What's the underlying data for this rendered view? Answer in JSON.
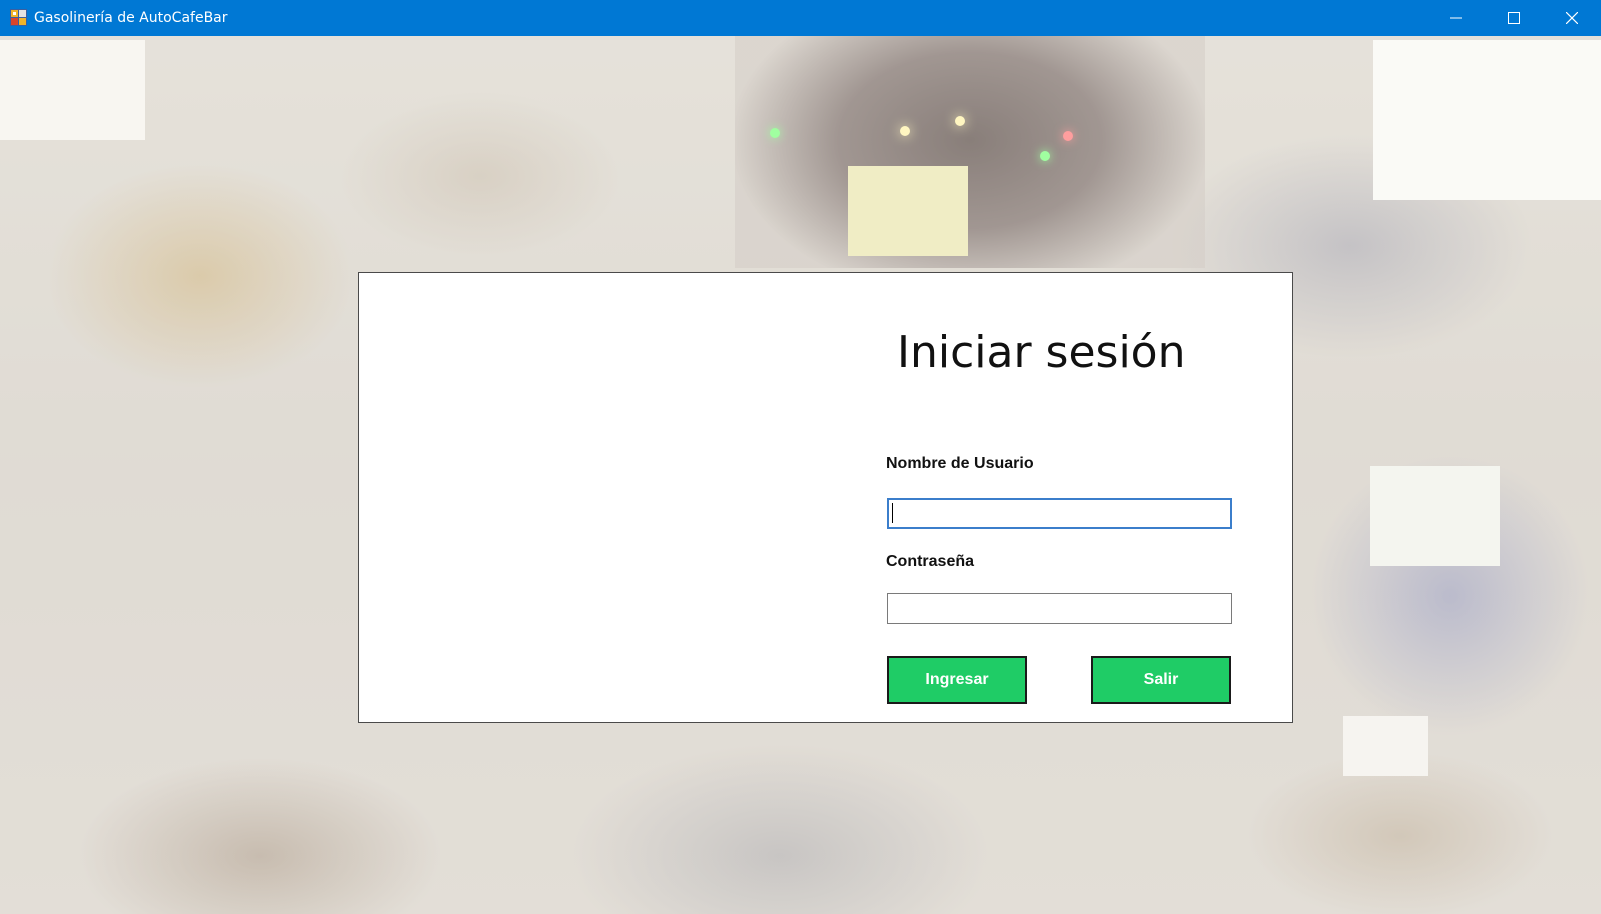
{
  "window": {
    "title": "Gasolinería de AutoCafeBar",
    "controls": {
      "minimize": "minimize-icon",
      "maximize": "maximize-icon",
      "close": "close-icon"
    },
    "titlebar_color": "#0078d4"
  },
  "login": {
    "title": "Iniciar sesión",
    "username_label": "Nombre de Usuario",
    "username_value": "",
    "password_label": "Contraseña",
    "password_value": "",
    "submit_label": "Ingresar",
    "exit_label": "Salir",
    "button_color": "#1fcc66"
  }
}
